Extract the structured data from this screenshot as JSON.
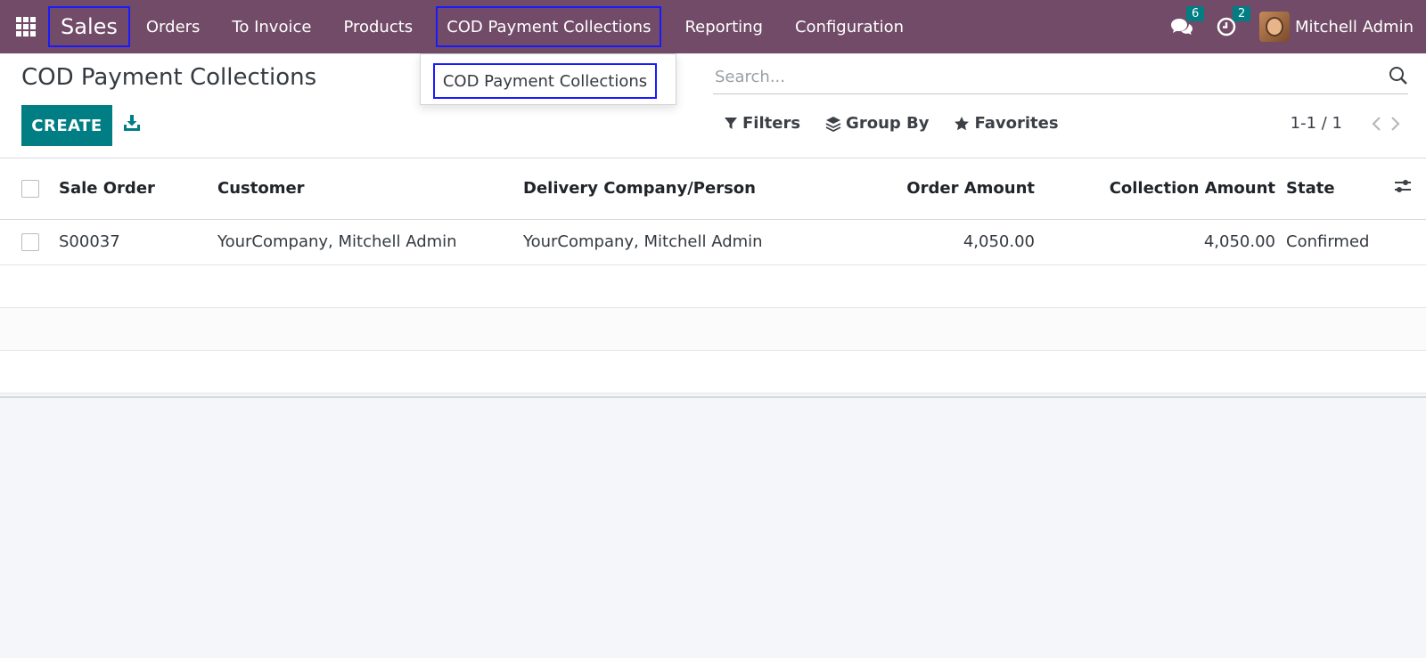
{
  "navbar": {
    "brand": "Sales",
    "menu": [
      "Orders",
      "To Invoice",
      "Products",
      "COD Payment Collections",
      "Reporting",
      "Configuration"
    ],
    "messages_count": "6",
    "activities_count": "2",
    "user_name": "Mitchell Admin",
    "color": "#714b67"
  },
  "dropdown": {
    "item": "COD Payment Collections"
  },
  "control_panel": {
    "title": "COD Payment Collections",
    "create_label": "CREATE",
    "search_placeholder": "Search...",
    "filters_label": "Filters",
    "group_by_label": "Group By",
    "favorites_label": "Favorites",
    "pager": "1-1 / 1",
    "accent": "#017e84"
  },
  "table": {
    "headers": {
      "sale_order": "Sale Order",
      "customer": "Customer",
      "delivery": "Delivery Company/Person",
      "order_amount": "Order Amount",
      "collection_amount": "Collection Amount",
      "state": "State"
    },
    "rows": [
      {
        "sale_order": "S00037",
        "customer": "YourCompany, Mitchell Admin",
        "delivery": "YourCompany, Mitchell Admin",
        "order_amount": "4,050.00",
        "collection_amount": "4,050.00",
        "state": "Confirmed"
      }
    ]
  }
}
